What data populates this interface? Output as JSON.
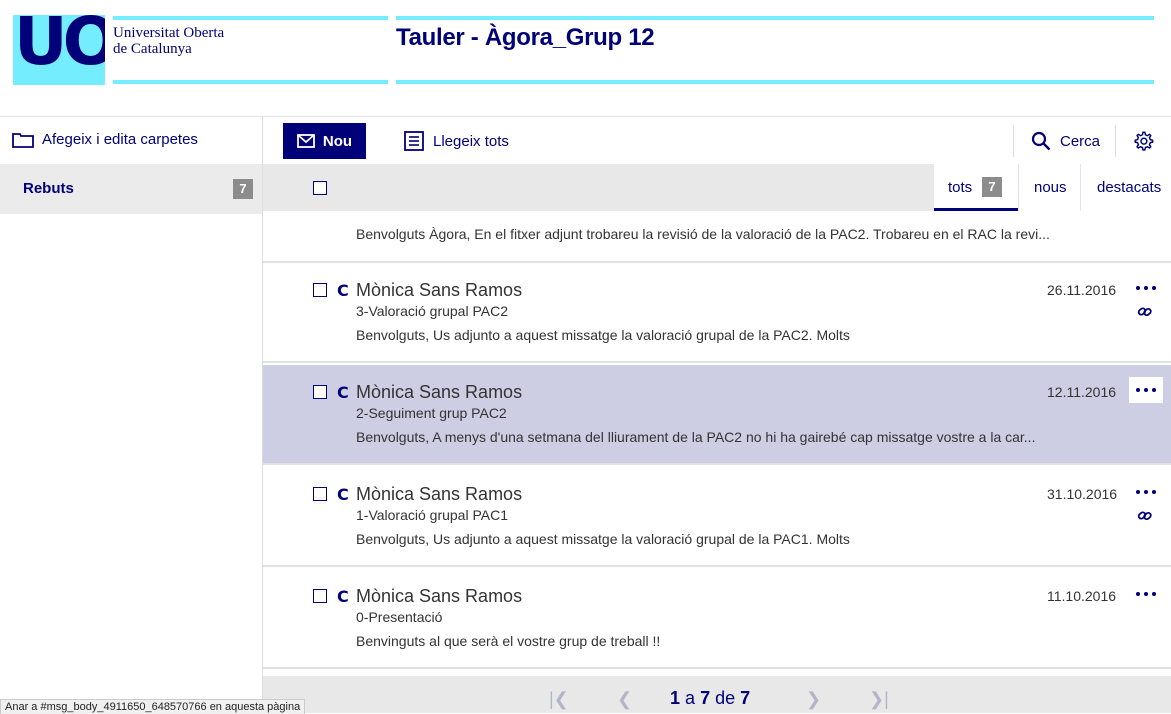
{
  "header": {
    "logo_text": "UOC",
    "university_line1": "Universitat Oberta",
    "university_line2": "de Catalunya",
    "board_title": "Tauler - Àgora_Grup 12"
  },
  "sidebar": {
    "folders_link": "Afegeix i edita carpetes",
    "inbox_label": "Rebuts",
    "inbox_count": "7"
  },
  "toolbar": {
    "new_label": "Nou",
    "read_all_label": "Llegeix tots",
    "search_label": "Cerca"
  },
  "filters": {
    "all_label": "tots",
    "all_count": "7",
    "new_label": "nous",
    "featured_label": "destacats"
  },
  "partial_message": {
    "preview": "Benvolguts Àgora, En el fitxer adjunt trobareu la revisió de la valoració de la PAC2. Trobareu en el RAC la revi..."
  },
  "messages": [
    {
      "flag": "C",
      "sender": "Mònica Sans Ramos",
      "subject": "3-Valoració grupal PAC2",
      "preview": "Benvolguts,   Us adjunto a aquest missatge la valoració grupal de la PAC2. Molts",
      "date": "26.11.2016",
      "attachment": true,
      "selected": false
    },
    {
      "flag": "C",
      "sender": "Mònica Sans Ramos",
      "subject": "2-Seguiment grup PAC2",
      "preview": "Benvolguts,   A menys d'una setmana del lliurament de la PAC2 no hi ha gairebé cap missatge vostre a la car...",
      "date": "12.11.2016",
      "attachment": false,
      "selected": true
    },
    {
      "flag": "C",
      "sender": "Mònica Sans Ramos",
      "subject": "1-Valoració grupal PAC1",
      "preview": "Benvolguts,   Us adjunto a aquest missatge la valoració grupal de la PAC1. Molts",
      "date": "31.10.2016",
      "attachment": true,
      "selected": false
    },
    {
      "flag": "C",
      "sender": "Mònica Sans Ramos",
      "subject": "0-Presentació",
      "preview": "Benvinguts al que serà el vostre grup de treball !!",
      "date": "11.10.2016",
      "attachment": false,
      "selected": false
    }
  ],
  "pagination": {
    "from": "1",
    "word_to": "a",
    "to": "7",
    "word_of": "de",
    "total": "7"
  },
  "status_bar": "Anar a #msg_body_4911650_648570766 en aquesta pàgina",
  "colors": {
    "brand_navy": "#000078",
    "brand_cyan": "#73edff",
    "selected_row": "#cdcde3"
  }
}
